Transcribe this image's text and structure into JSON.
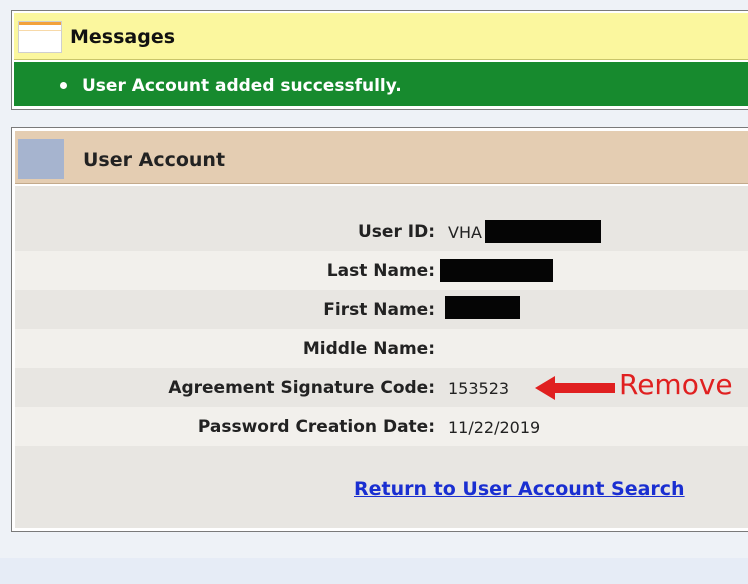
{
  "messages": {
    "title": "Messages",
    "items": [
      "User Account added successfully."
    ]
  },
  "user_account": {
    "title": "User Account",
    "fields": [
      {
        "label": "User ID:",
        "value": "VHA",
        "redacted": true
      },
      {
        "label": "Last Name:",
        "value": "",
        "redacted": true
      },
      {
        "label": "First Name:",
        "value": "",
        "redacted": true
      },
      {
        "label": "Middle Name:",
        "value": ""
      },
      {
        "label": "Agreement Signature Code:",
        "value": "153523"
      },
      {
        "label": "Password Creation Date:",
        "value": "11/22/2019"
      }
    ],
    "annotation": "Remove",
    "return_link": "Return to User Account Search"
  },
  "colors": {
    "messages_header": "#fbf79e",
    "success_bar": "#178a2e",
    "account_header": "#e4cdb2",
    "annotation": "#e02020",
    "link": "#1a2fd1"
  },
  "icons": {
    "messages": "messages-icon",
    "account": "account-icon",
    "annotation": "red-arrow-icon"
  }
}
